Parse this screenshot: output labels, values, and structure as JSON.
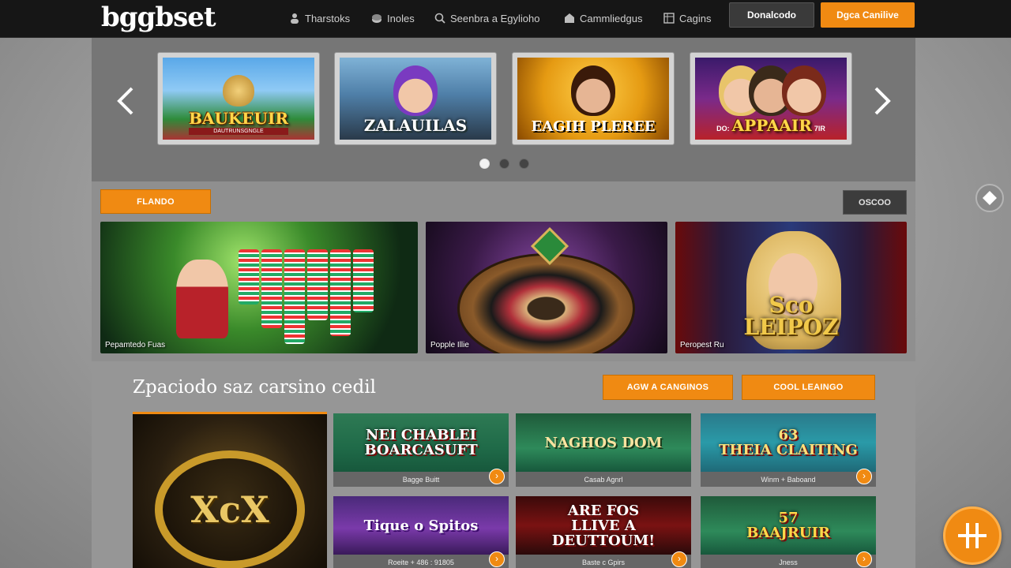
{
  "header": {
    "logo": "bggbset",
    "nav": [
      {
        "label": "Tharstoks",
        "icon": "user-icon"
      },
      {
        "label": "Inoles",
        "icon": "chip-icon"
      },
      {
        "label": "Seenbra a Egylioho",
        "icon": "search-icon"
      },
      {
        "label": "Cammliedgus",
        "icon": "home-icon"
      },
      {
        "label": "Cagins",
        "icon": "grid-icon"
      }
    ],
    "btn_dark": "Donalcodo",
    "btn_orange": "Dgca Canilive"
  },
  "carousel": {
    "slides": [
      {
        "title": "BAUKEUIR",
        "sub": "DAUTRUNSGNGLE"
      },
      {
        "title": "ZALAUILAS"
      },
      {
        "title": "EAGIH PLEREE"
      },
      {
        "title": "APPAAIR",
        "prefix": "DO:",
        "suffix": "7IR"
      }
    ],
    "dots": 3,
    "active_dot": 0
  },
  "section2": {
    "btn_left": "FLANDO",
    "btn_right": "OSCOO",
    "heroes": [
      {
        "caption": "Pepamtedo Fuas"
      },
      {
        "caption": "Popple Illie"
      },
      {
        "caption": "Peropest Ru",
        "logo": "Sco\nLEIPOZ"
      }
    ]
  },
  "section3": {
    "title": "Zpaciodo saz carsino cedil",
    "btn_1": "AGW A CANGINOS",
    "btn_2": "COOL LEAINGO",
    "feature_text": "XcX",
    "tiles": [
      {
        "art": "NEI CHABLEI\nBOARCASUFT",
        "label": "Bagge Buitt"
      },
      {
        "art": "NAGHOS DOM",
        "label": "Casab Agnrl"
      },
      {
        "art": "63\nTHEIA CLAITING",
        "label": "Winm + Baboand"
      },
      {
        "art": "Tique o Spitos",
        "label": "Roeite + 486 : 91805"
      },
      {
        "art": "ARE FOS\nLLIVE A\nDEUTTOUM!",
        "label": "Baste c Gpirs"
      },
      {
        "art": "57\nBAAJRUIR",
        "label": "Jness"
      }
    ]
  },
  "colors": {
    "accent": "#f08a12",
    "topbar": "#161616"
  }
}
